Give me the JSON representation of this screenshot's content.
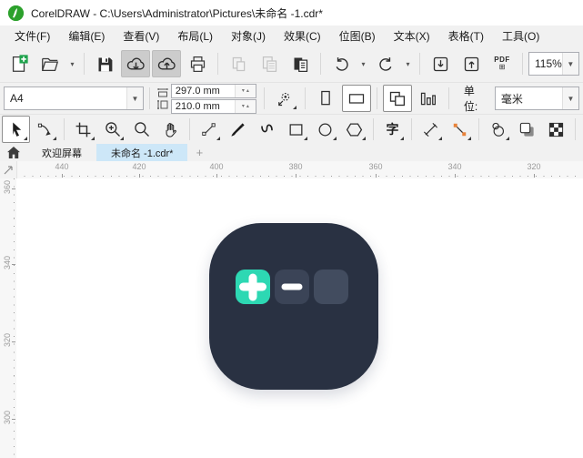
{
  "window": {
    "title": "CorelDRAW - C:\\Users\\Administrator\\Pictures\\未命名 -1.cdr*"
  },
  "menus": [
    {
      "label": "文件(F)"
    },
    {
      "label": "编辑(E)"
    },
    {
      "label": "查看(V)"
    },
    {
      "label": "布局(L)"
    },
    {
      "label": "对象(J)"
    },
    {
      "label": "效果(C)"
    },
    {
      "label": "位图(B)"
    },
    {
      "label": "文本(X)"
    },
    {
      "label": "表格(T)"
    },
    {
      "label": "工具(O)"
    }
  ],
  "toolbar": {
    "zoom_level": "115%",
    "pdf_label": "PDF"
  },
  "property_bar": {
    "page_size": "A4",
    "page_width": "297.0 mm",
    "page_height": "210.0 mm",
    "units_label": "单位:",
    "units_value": "毫米"
  },
  "toolbox": {
    "text_tool_label": "字"
  },
  "tab_bar": {
    "welcome_tab": "欢迎屏幕",
    "document_tab": "未命名 -1.cdr*",
    "new_tab_label": "+"
  },
  "rulers": {
    "horizontal_labels": [
      "440",
      "420",
      "400",
      "380",
      "360",
      "340",
      "320"
    ],
    "vertical_labels": [
      "360",
      "340",
      "320",
      "300"
    ]
  },
  "artwork": {
    "colors": {
      "tile": "#293142",
      "plus_button": "#2dd8b3",
      "minus_button": "#3b4457",
      "empty_button": "#424c5f",
      "glyph": "#ffffff"
    }
  },
  "accents": {
    "tab_underline": "#1e96d6",
    "active_tab_bg": "#cde7f8"
  }
}
